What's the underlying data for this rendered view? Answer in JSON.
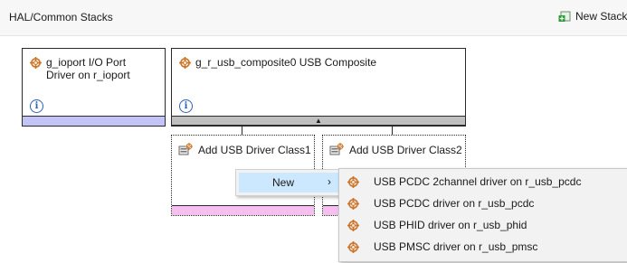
{
  "header": {
    "title": "HAL/Common Stacks",
    "new_stack_label": "New Stack"
  },
  "cards": {
    "ioport": {
      "title_line1": "g_ioport I/O Port",
      "title_line2": "Driver on r_ioport",
      "info_glyph": "i",
      "strip_color": "#c3c3f7"
    },
    "usb": {
      "title": "g_r_usb_composite0 USB Composite",
      "info_glyph": "i",
      "collapse_glyph": "▲",
      "strip_color": "#bfbfbf"
    }
  },
  "usb_classes": [
    {
      "label": "Add USB Driver Class1"
    },
    {
      "label": "Add USB Driver Class2"
    }
  ],
  "context_menu": {
    "new_label": "New",
    "submenu_arrow": "›",
    "hover_color": "#cce8ff"
  },
  "submenu": {
    "items": [
      {
        "label": "USB PCDC 2channel driver on r_usb_pcdc"
      },
      {
        "label": "USB PCDC driver on r_usb_pcdc"
      },
      {
        "label": "USB PHID driver on r_usb_phid"
      },
      {
        "label": "USB PMSC driver on r_usb_pmsc"
      }
    ]
  },
  "colors": {
    "gear": "#c9762a",
    "class_strip": "#f5bff0",
    "info": "#2c63b3"
  }
}
